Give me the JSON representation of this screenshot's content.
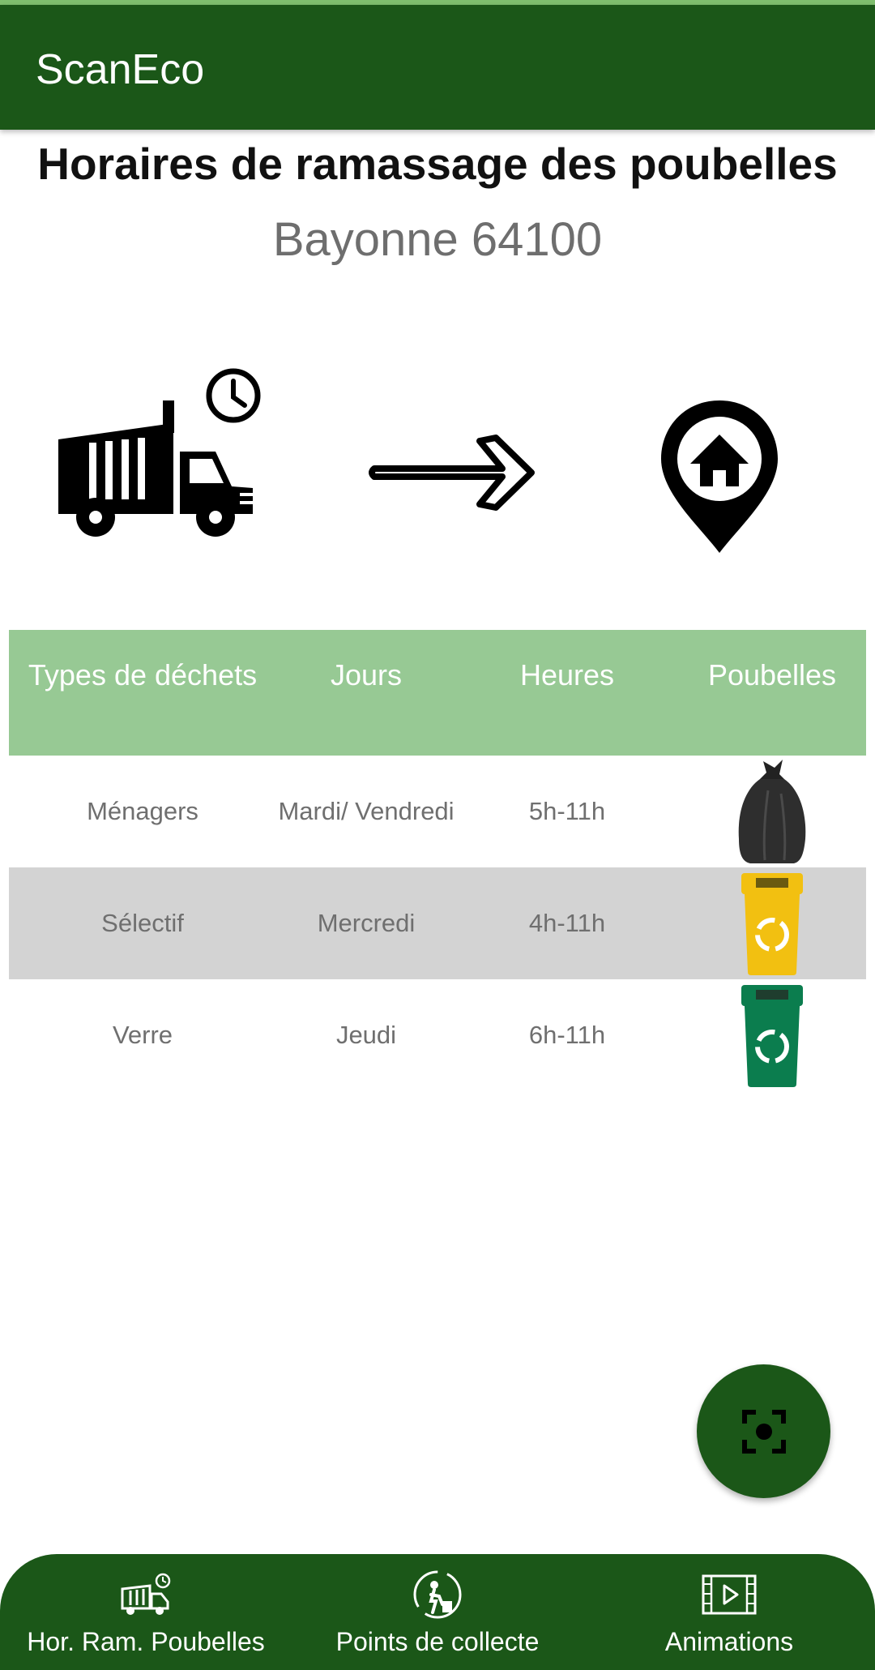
{
  "app_bar": {
    "title": "ScanEco"
  },
  "header": {
    "title": "Horaires de ramassage des poubelles",
    "city": "Bayonne 64100"
  },
  "icons": {
    "illustration": [
      "garbage-truck-clock-icon",
      "right-arrow-icon",
      "home-location-pin-icon"
    ],
    "fab": "scan-focus-icon"
  },
  "table": {
    "headers": [
      "Types de déchets",
      "Jours",
      "Heures",
      "Poubelles"
    ],
    "rows": [
      {
        "type": "Ménagers",
        "days": "Mardi/ Vendredi",
        "hours": "5h-11h",
        "bin": "black-trash-bag"
      },
      {
        "type": "Sélectif",
        "days": "Mercredi",
        "hours": "4h-11h",
        "bin": "yellow-recycling-bin"
      },
      {
        "type": "Verre",
        "days": "Jeudi",
        "hours": "6h-11h",
        "bin": "green-recycling-bin"
      }
    ]
  },
  "bottom_nav": {
    "items": [
      {
        "label": "Hor. Ram. Poubelles",
        "icon": "garbage-truck-icon"
      },
      {
        "label": "Points de collecte",
        "icon": "recycling-person-icon"
      },
      {
        "label": "Animations",
        "icon": "video-film-icon"
      }
    ]
  },
  "colors": {
    "primary": "#1b5718",
    "header_row": "#97c994",
    "alt_row": "#d3d3d3",
    "accent_strip": "#7fbf6e",
    "bin_yellow": "#f2c011",
    "bin_green": "#0b7d4e"
  }
}
